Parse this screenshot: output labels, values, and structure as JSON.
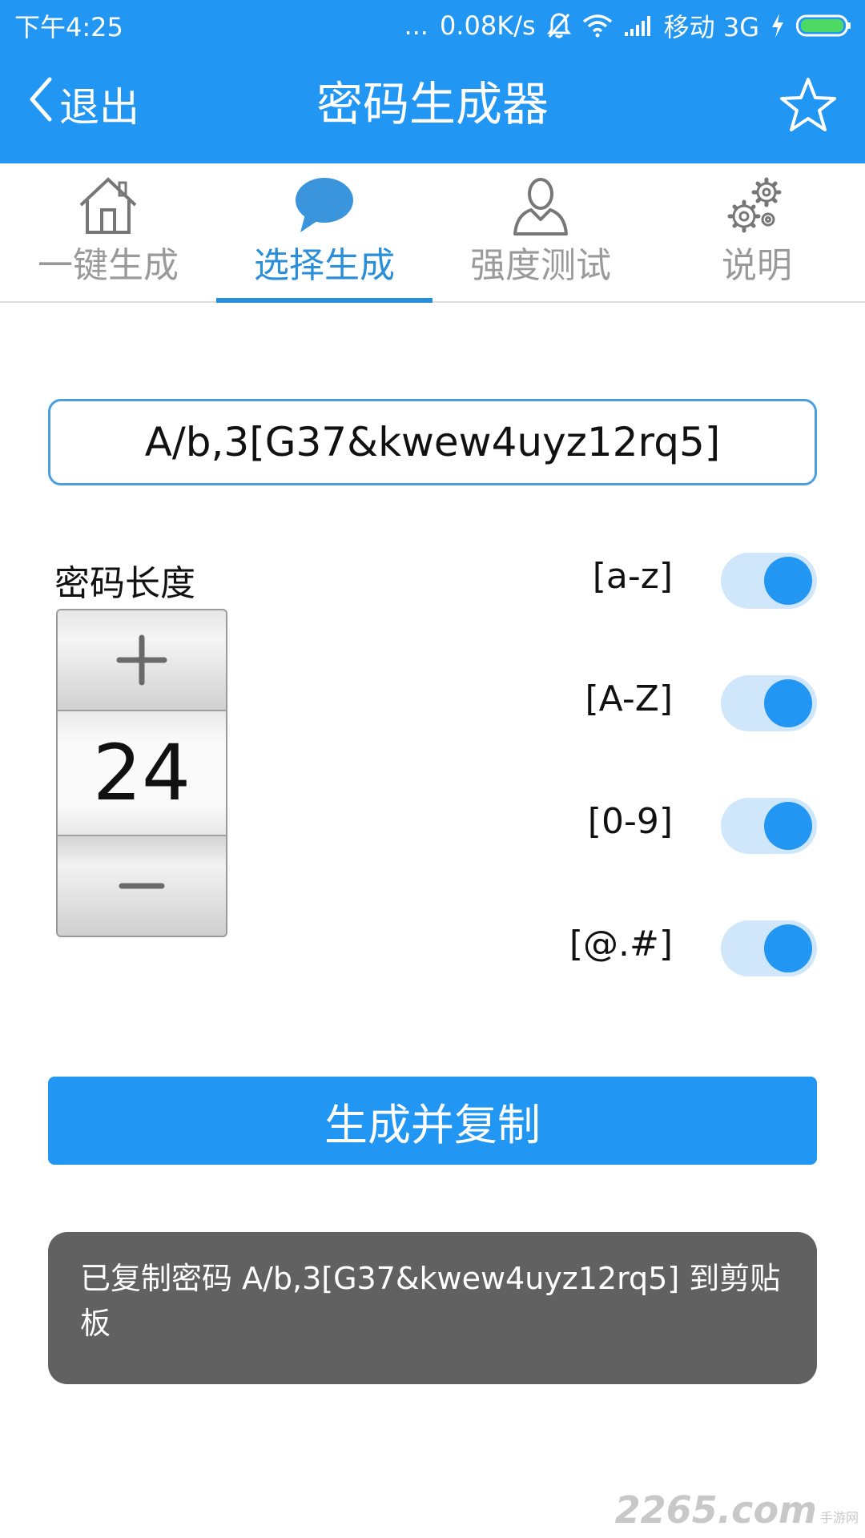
{
  "status_bar": {
    "time": "下午4:25",
    "dots": "...",
    "speed": "0.08K/s",
    "carrier": "移动 3G"
  },
  "app_bar": {
    "back_label": "退出",
    "title": "密码生成器"
  },
  "tabs": [
    {
      "label": "一键生成",
      "icon": "home-icon",
      "active": false
    },
    {
      "label": "选择生成",
      "icon": "chat-bubble-icon",
      "active": true
    },
    {
      "label": "强度测试",
      "icon": "user-icon",
      "active": false
    },
    {
      "label": "说明",
      "icon": "gear-icon",
      "active": false
    }
  ],
  "password": {
    "value": "A/b,3[G37&kwew4uyz12rq5]"
  },
  "length": {
    "label": "密码长度",
    "value": "24"
  },
  "options": [
    {
      "label": "[a-z]",
      "enabled": true
    },
    {
      "label": "[A-Z]",
      "enabled": true
    },
    {
      "label": "[0-9]",
      "enabled": true
    },
    {
      "label": "[@.#]",
      "enabled": true
    }
  ],
  "generate_button": {
    "label": "生成并复制"
  },
  "toast": {
    "message": "已复制密码 A/b,3[G37&kwew4uyz12rq5] 到剪贴板"
  },
  "watermark": {
    "main": "2265.com",
    "sub": "手游网"
  },
  "colors": {
    "primary": "#2196f3",
    "tab_active": "#2a8fd8",
    "switch_track": "#cfe6fb",
    "toast_bg": "#616161"
  }
}
